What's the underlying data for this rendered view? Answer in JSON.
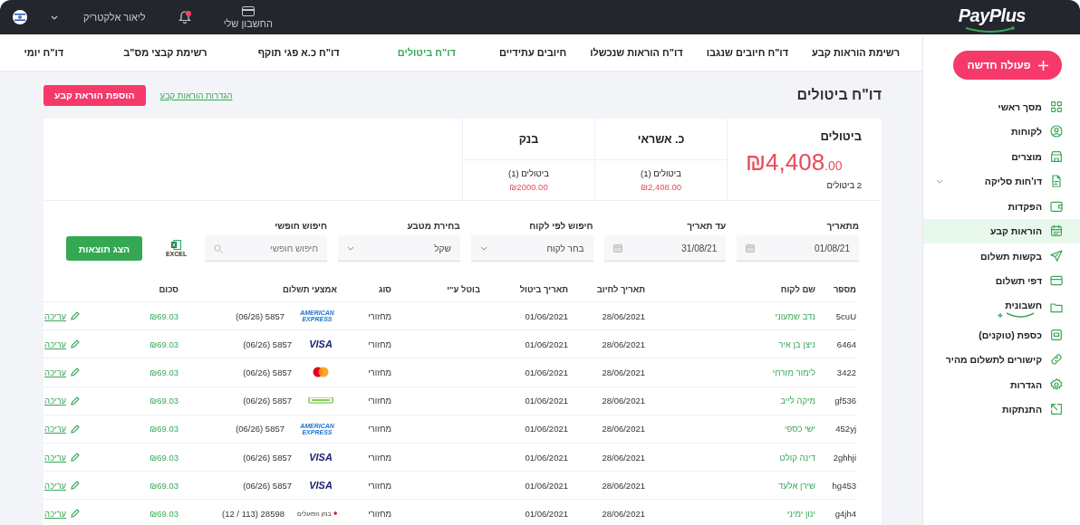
{
  "top_bar": {
    "logo": "PayPlus",
    "account": {
      "label": "החשבון שלי"
    },
    "notifications": {
      "unread": true
    },
    "user": {
      "name": "ליאור אלקטריק"
    }
  },
  "sidebar": {
    "new_action": {
      "label": "פעולה חדשה"
    },
    "items": [
      {
        "label": "מסך ראשי",
        "kind": "link",
        "selected": false
      },
      {
        "label": "לקוחות",
        "kind": "link",
        "selected": false
      },
      {
        "label": "מוצרים",
        "kind": "link",
        "selected": false
      },
      {
        "label": "דו'חות סליקה",
        "kind": "group",
        "selected": false
      },
      {
        "label": "הפקדות",
        "kind": "link",
        "selected": false
      },
      {
        "label": "הוראות קבע",
        "kind": "link",
        "selected": true
      },
      {
        "label": "בקשות תשלום",
        "kind": "link",
        "selected": false
      },
      {
        "label": "דפי תשלום",
        "kind": "link",
        "selected": false
      },
      {
        "label": "חשבונית",
        "kind": "brand",
        "selected": false
      },
      {
        "label": "כספת (טוקנים)",
        "kind": "link",
        "selected": false
      },
      {
        "label": "קישורים לתשלום מהיר",
        "kind": "link",
        "selected": false
      },
      {
        "label": "הגדרות",
        "kind": "link",
        "selected": false
      },
      {
        "label": "התנתקות",
        "kind": "link",
        "selected": false
      }
    ]
  },
  "tabs": [
    {
      "label": "רשימת הוראות קבע",
      "selected": false
    },
    {
      "label": "דו\"ח חיובים שנגבו",
      "selected": false
    },
    {
      "label": "דו\"ח הוראות שנכשלו",
      "selected": false
    },
    {
      "label": "חיובים עתידיים",
      "selected": false
    },
    {
      "label": "דו\"ח ביטולים",
      "selected": true
    },
    {
      "label": "דו\"ח כ.א פגי תוקף",
      "selected": false
    },
    {
      "label": "רשימת קבצי מס\"ב",
      "selected": false
    },
    {
      "label": "דו\"ח יומי",
      "selected": false
    }
  ],
  "page": {
    "title": "דו\"ח ביטולים",
    "settings_link": "הגדרות הוראות קבע",
    "add_button": "הוספת הוראת קבע"
  },
  "summary": {
    "total": {
      "label": "ביטולים",
      "amount": "₪4,408",
      "cents": ".00",
      "count": "2 ביטולים"
    },
    "breakdown": [
      {
        "title": "כ. אשראי",
        "count": "ביטולים (1)",
        "amount": "₪2,408.00"
      },
      {
        "title": "בנק",
        "count": "ביטולים (1)",
        "amount": "₪2000.00"
      }
    ]
  },
  "filters": {
    "fields": [
      {
        "label": "מתאריך",
        "kind": "date",
        "value": "01/08/21"
      },
      {
        "label": "עד תאריך",
        "kind": "date",
        "value": "31/08/21"
      },
      {
        "label": "חיפוש לפי לקוח",
        "kind": "select",
        "value": "בחר לקוח"
      },
      {
        "label": "בחירת מטבע",
        "kind": "select",
        "value": "שקל"
      },
      {
        "label": "חיפוש חופשי",
        "kind": "search",
        "placeholder": "חיפוש חופשי"
      }
    ],
    "export": {
      "label": "EXCEL"
    },
    "submit": "הצג תוצאות"
  },
  "table": {
    "columns": [
      "מספר",
      "שם לקוח",
      "תאריך לחיוב",
      "תאריך ביטול",
      "בוטל ע\"י",
      "סוג",
      "אמצעי תשלום",
      "סכום"
    ],
    "rows": [
      {
        "number": "5cuU",
        "customer": "נדב שמעוני",
        "charge_date": "28/06/2021",
        "cancel_date": "01/06/2021",
        "type": "מחזורי",
        "payment": {
          "kind": "amex",
          "logo": "AMERICAN EXPRESS",
          "details": "(06/26) 5857"
        },
        "amount": "₪69.03",
        "action": "עריכה"
      },
      {
        "number": "6464",
        "customer": "ניצן בן איר",
        "charge_date": "28/06/2021",
        "cancel_date": "01/06/2021",
        "type": "מחזורי",
        "payment": {
          "kind": "visa",
          "logo": "VISA",
          "details": "(06/26) 5857"
        },
        "amount": "₪69.03",
        "action": "עריכה"
      },
      {
        "number": "3422",
        "customer": "לימור מזרחי",
        "charge_date": "28/06/2021",
        "cancel_date": "01/06/2021",
        "type": "מחזורי",
        "payment": {
          "kind": "mastercard",
          "details": "(06/26) 5857"
        },
        "amount": "₪69.03",
        "action": "עריכה"
      },
      {
        "number": "gf536",
        "customer": "מיקה לייב",
        "charge_date": "28/06/2021",
        "cancel_date": "01/06/2021",
        "type": "מחזורי",
        "payment": {
          "kind": "green-card",
          "details": "(06/26) 5857"
        },
        "amount": "₪69.03",
        "action": "עריכה"
      },
      {
        "number": "452yj",
        "customer": "ישי כספי",
        "charge_date": "28/06/2021",
        "cancel_date": "01/06/2021",
        "type": "מחזורי",
        "payment": {
          "kind": "amex",
          "logo": "AMERICAN EXPRESS",
          "details": "(06/26) 5857"
        },
        "amount": "₪69.03",
        "action": "עריכה"
      },
      {
        "number": "2ghhji",
        "customer": "דינה קולט",
        "charge_date": "28/06/2021",
        "cancel_date": "01/06/2021",
        "type": "מחזורי",
        "payment": {
          "kind": "visa",
          "logo": "VISA",
          "details": "(06/26) 5857"
        },
        "amount": "₪69.03",
        "action": "עריכה"
      },
      {
        "number": "hg453",
        "customer": "שירן אלעד",
        "charge_date": "28/06/2021",
        "cancel_date": "01/06/2021",
        "type": "מחזורי",
        "payment": {
          "kind": "visa",
          "logo": "VISA",
          "details": "(06/26) 5857"
        },
        "amount": "₪69.03",
        "action": "עריכה"
      },
      {
        "number": "g4jh4",
        "customer": "ינון ימיני",
        "charge_date": "28/06/2021",
        "cancel_date": "01/06/2021",
        "type": "מחזורי",
        "payment": {
          "kind": "bank",
          "logo": "בנק הפועלים",
          "details": "(12 / 113) 28598"
        },
        "amount": "₪69.03",
        "action": "עריכה"
      }
    ]
  }
}
